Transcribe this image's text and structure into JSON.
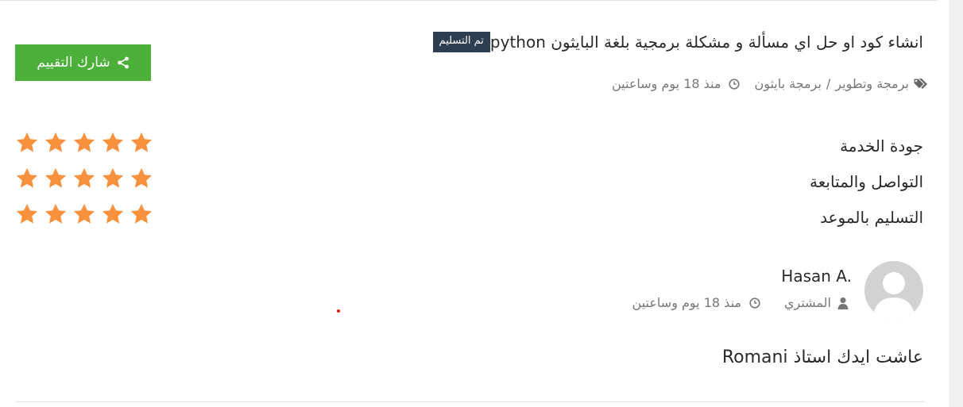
{
  "project": {
    "status_badge": "تم التسليم",
    "title": "انشاء كود او حل اي مسألة و مشكلة برمجية بلغة البايثون python",
    "category": "برمجة وتطوير",
    "subcategory": "برمجة بايثون",
    "time_ago": "منذ 18 يوم وساعتين"
  },
  "share_button": {
    "label": "شارك التقييم",
    "icon": "share-icon",
    "color": "#4caf3a"
  },
  "ratings": [
    {
      "label": "جودة الخدمة",
      "stars": 5,
      "max": 5
    },
    {
      "label": "التواصل والمتابعة",
      "stars": 5,
      "max": 5
    },
    {
      "label": "التسليم بالموعد",
      "stars": 5,
      "max": 5
    }
  ],
  "star_color": "#f7913d",
  "reviewer": {
    "name": "Hasan A.",
    "role": "المشتري",
    "time_ago": "منذ 18 يوم وساعتين"
  },
  "comment": "عاشت ايدك استاذ Romani"
}
